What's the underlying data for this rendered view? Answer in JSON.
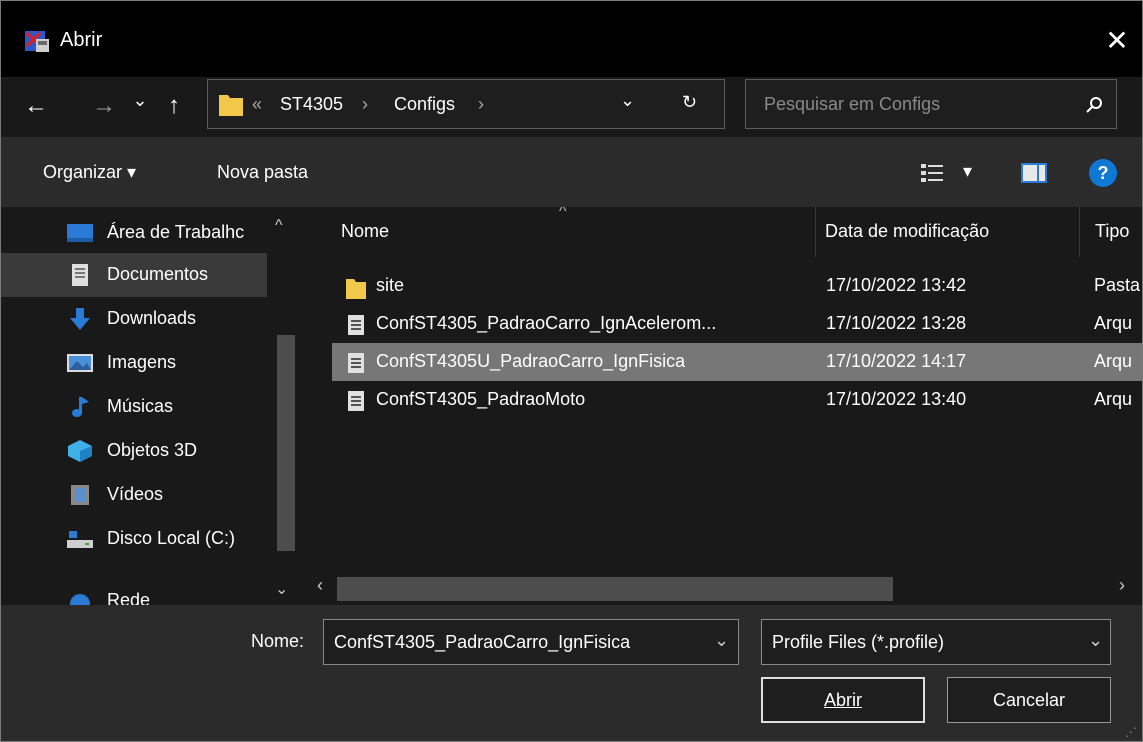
{
  "window": {
    "title": "Abrir",
    "close_glyph": "✕"
  },
  "nav": {
    "back": "←",
    "forward": "→",
    "recent": "⌄",
    "up": "↑"
  },
  "address": {
    "chevrons": "«",
    "crumbs": [
      "ST4305",
      "Configs"
    ],
    "sep": "›",
    "dropdown": "⌄",
    "refresh": "↻"
  },
  "search": {
    "placeholder": "Pesquisar em Configs"
  },
  "toolbar": {
    "organize": "Organizar ▾",
    "new_folder": "Nova pasta",
    "view_menu": "▾",
    "help": "?"
  },
  "sidebar": {
    "items": [
      {
        "label": "Área de Trabalhc",
        "icon": "desktop-icon"
      },
      {
        "label": "Documentos",
        "icon": "documents-icon",
        "selected": true
      },
      {
        "label": "Downloads",
        "icon": "downloads-icon"
      },
      {
        "label": "Imagens",
        "icon": "pictures-icon"
      },
      {
        "label": "Músicas",
        "icon": "music-icon"
      },
      {
        "label": "Objetos 3D",
        "icon": "objects-3d-icon"
      },
      {
        "label": "Vídeos",
        "icon": "videos-icon"
      },
      {
        "label": "Disco Local (C:)",
        "icon": "local-disk-icon"
      },
      {
        "label": "Rede",
        "icon": "network-icon"
      }
    ]
  },
  "filelist": {
    "columns": {
      "name": "Nome",
      "date": "Data de modificação",
      "type": "Tipo"
    },
    "rows": [
      {
        "name": "site",
        "date": "17/10/2022 13:42",
        "type": "Pasta",
        "icon": "folder-icon"
      },
      {
        "name": "ConfST4305_PadraoCarro_IgnAcelerom...",
        "date": "17/10/2022 13:28",
        "type": "Arqu",
        "icon": "file-icon"
      },
      {
        "name": "ConfST4305U_PadraoCarro_IgnFisica",
        "date": "17/10/2022 14:17",
        "type": "Arqu",
        "icon": "file-icon",
        "selected": true
      },
      {
        "name": "ConfST4305_PadraoMoto",
        "date": "17/10/2022 13:40",
        "type": "Arqu",
        "icon": "file-icon"
      }
    ]
  },
  "footer": {
    "name_label": "Nome:",
    "name_value": "ConfST4305_PadraoCarro_IgnFisica",
    "filter_value": "Profile Files (*.profile)",
    "open_button": "Abrir",
    "cancel_button": "Cancelar"
  },
  "colors": {
    "background": "#191919",
    "selected_row": "#777777",
    "folder": "#f2c84b",
    "accent": "#0f78d4"
  }
}
